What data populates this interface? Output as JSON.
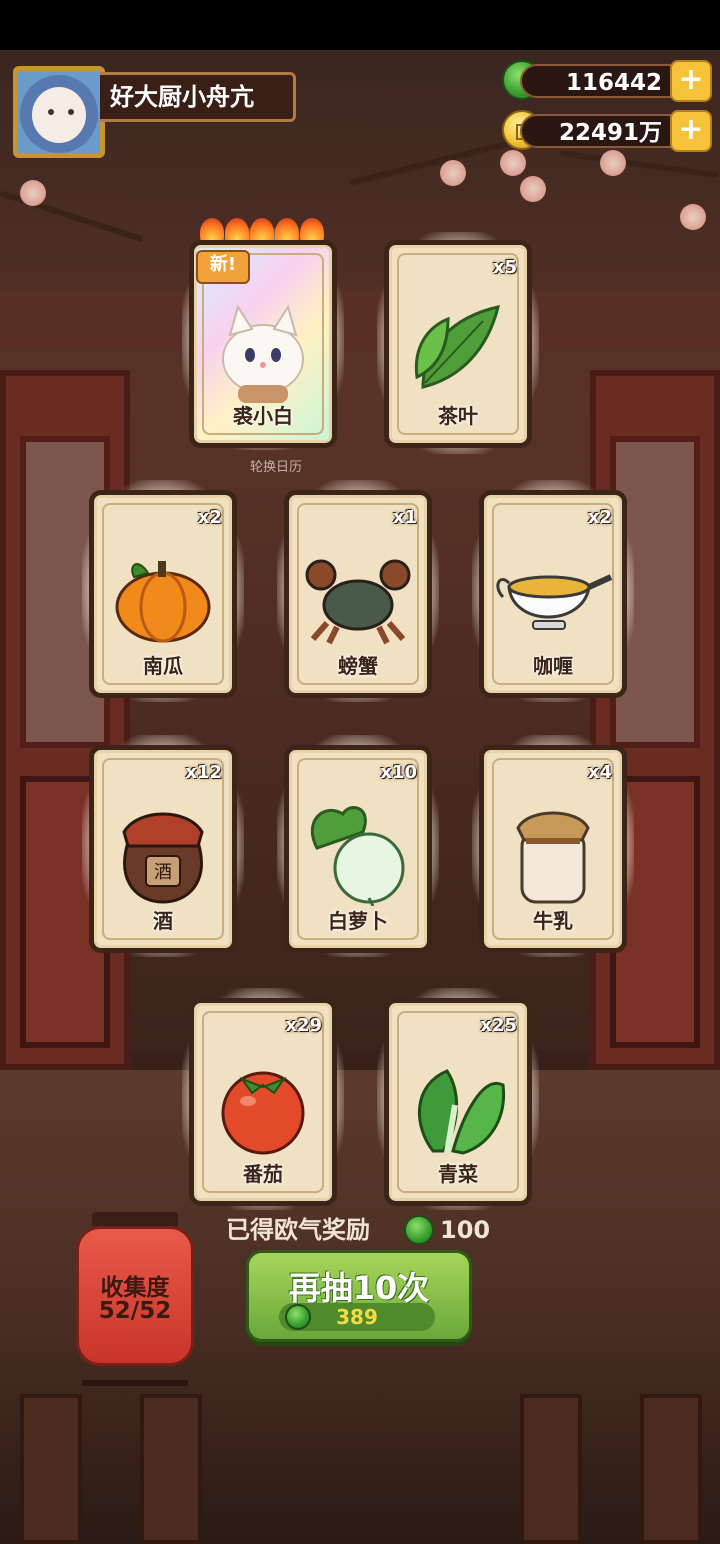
{
  "profile": {
    "name": "好大厨小舟亢"
  },
  "currency": {
    "jade": {
      "icon": "jade-icon",
      "value": "116442"
    },
    "coins": {
      "icon": "coin-icon",
      "value": "22491万"
    },
    "plus_symbol": "+"
  },
  "featured": {
    "new_badge": "新!",
    "stars": 5,
    "caption": "轮换日历"
  },
  "cards": [
    {
      "label": "裘小白",
      "count": "",
      "icon": "white-cat-icon",
      "rare": true
    },
    {
      "label": "茶叶",
      "count": "x5",
      "icon": "tea-leaf-icon"
    },
    {
      "label": "南瓜",
      "count": "x2",
      "icon": "pumpkin-icon"
    },
    {
      "label": "螃蟹",
      "count": "x1",
      "icon": "crab-icon"
    },
    {
      "label": "咖喱",
      "count": "x2",
      "icon": "curry-icon"
    },
    {
      "label": "酒",
      "count": "x12",
      "icon": "wine-jar-icon",
      "jar_text": "酒"
    },
    {
      "label": "白萝卜",
      "count": "x10",
      "icon": "radish-icon"
    },
    {
      "label": "牛乳",
      "count": "x4",
      "icon": "milk-jar-icon"
    },
    {
      "label": "番茄",
      "count": "x29",
      "icon": "tomato-icon"
    },
    {
      "label": "青菜",
      "count": "x25",
      "icon": "greens-icon"
    }
  ],
  "collection": {
    "title": "收集度",
    "progress": "52/52"
  },
  "luck_reward": {
    "label": "已得欧气奖励",
    "value": "100",
    "icon": "jade-icon"
  },
  "draw_button": {
    "label": "再抽10次",
    "cost": "389",
    "icon": "jade-icon"
  },
  "colors": {
    "accent_gold": "#f5c23a",
    "button_green": "#6aa83a",
    "lantern_red": "#c9342a"
  }
}
